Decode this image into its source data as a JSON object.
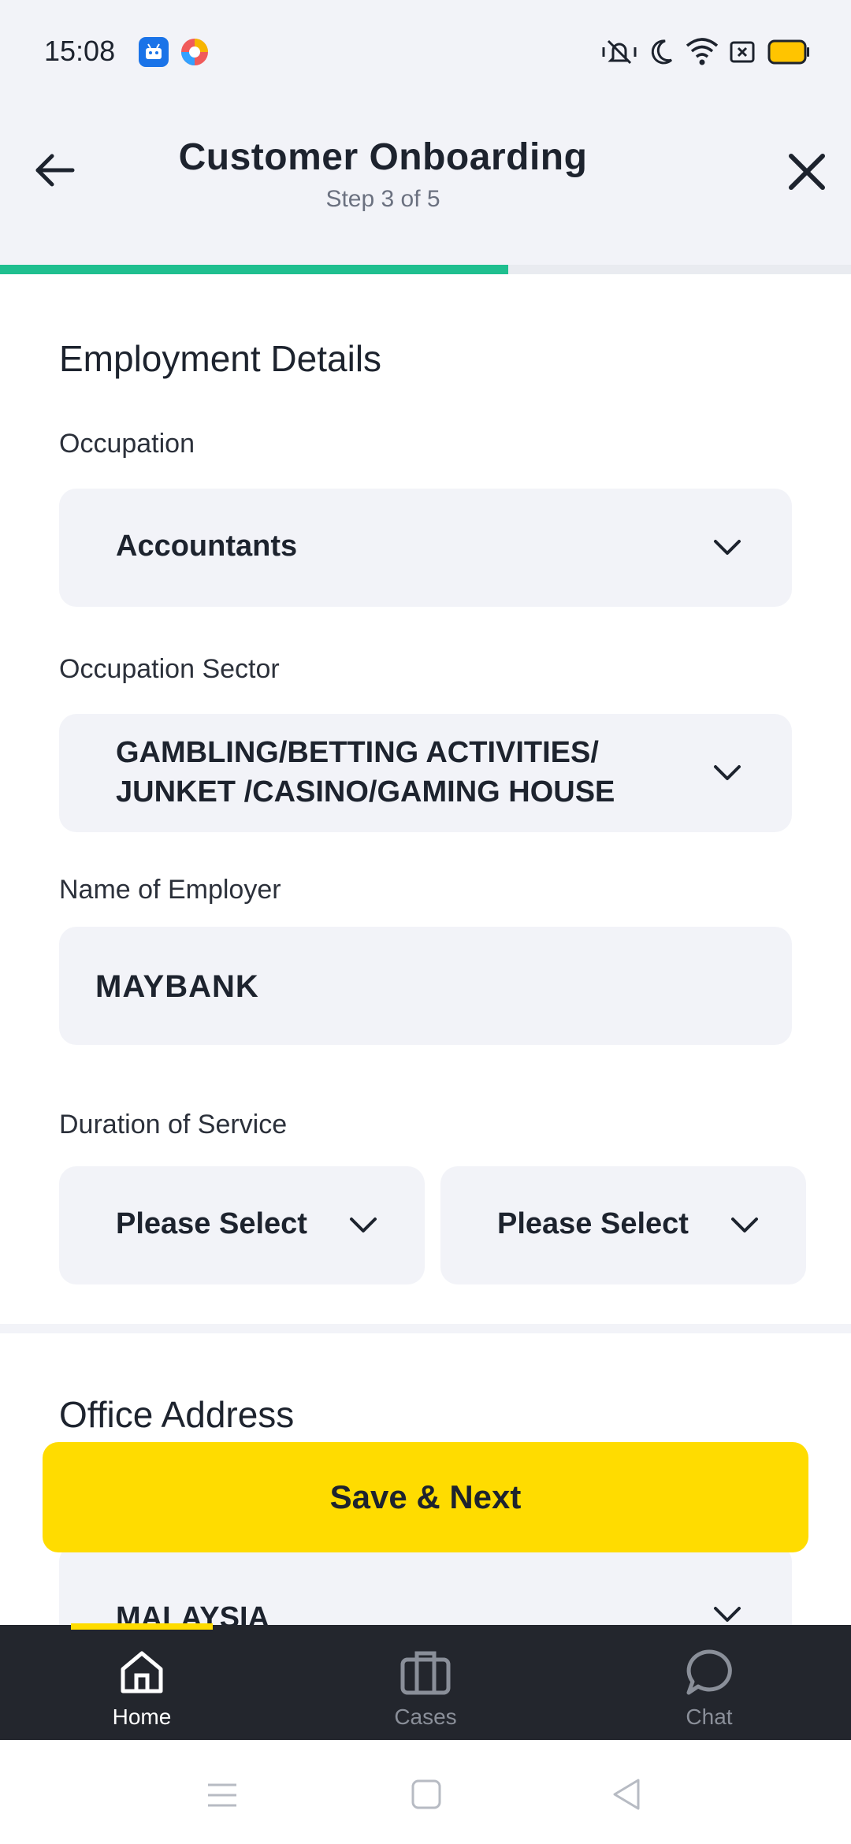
{
  "status_bar": {
    "time": "15:08"
  },
  "header": {
    "title": "Customer Onboarding",
    "step": "Step 3 of 5",
    "progress": 0.6
  },
  "employment": {
    "section_title": "Employment Details",
    "occupation_label": "Occupation",
    "occupation_value": "Accountants",
    "sector_label": "Occupation Sector",
    "sector_value_line1": "GAMBLING/BETTING ACTIVITIES/",
    "sector_value_line2": "JUNKET /CASINO/GAMING HOUSE",
    "employer_label": "Name of Employer",
    "employer_value": "MAYBANK",
    "duration_label": "Duration of Service",
    "duration_years": "Please Select",
    "duration_months": "Please Select"
  },
  "office": {
    "section_title": "Office Address",
    "country_value": "MALAYSIA"
  },
  "actions": {
    "save_next": "Save & Next"
  },
  "bottom_nav": {
    "items": [
      {
        "label": "Home",
        "active": true
      },
      {
        "label": "Cases",
        "active": false
      },
      {
        "label": "Chat",
        "active": false
      }
    ]
  },
  "colors": {
    "accent_yellow": "#ffdc00",
    "progress_green": "#1fbf8f",
    "field_bg": "#f2f3f8",
    "nav_bg": "#23262d"
  }
}
